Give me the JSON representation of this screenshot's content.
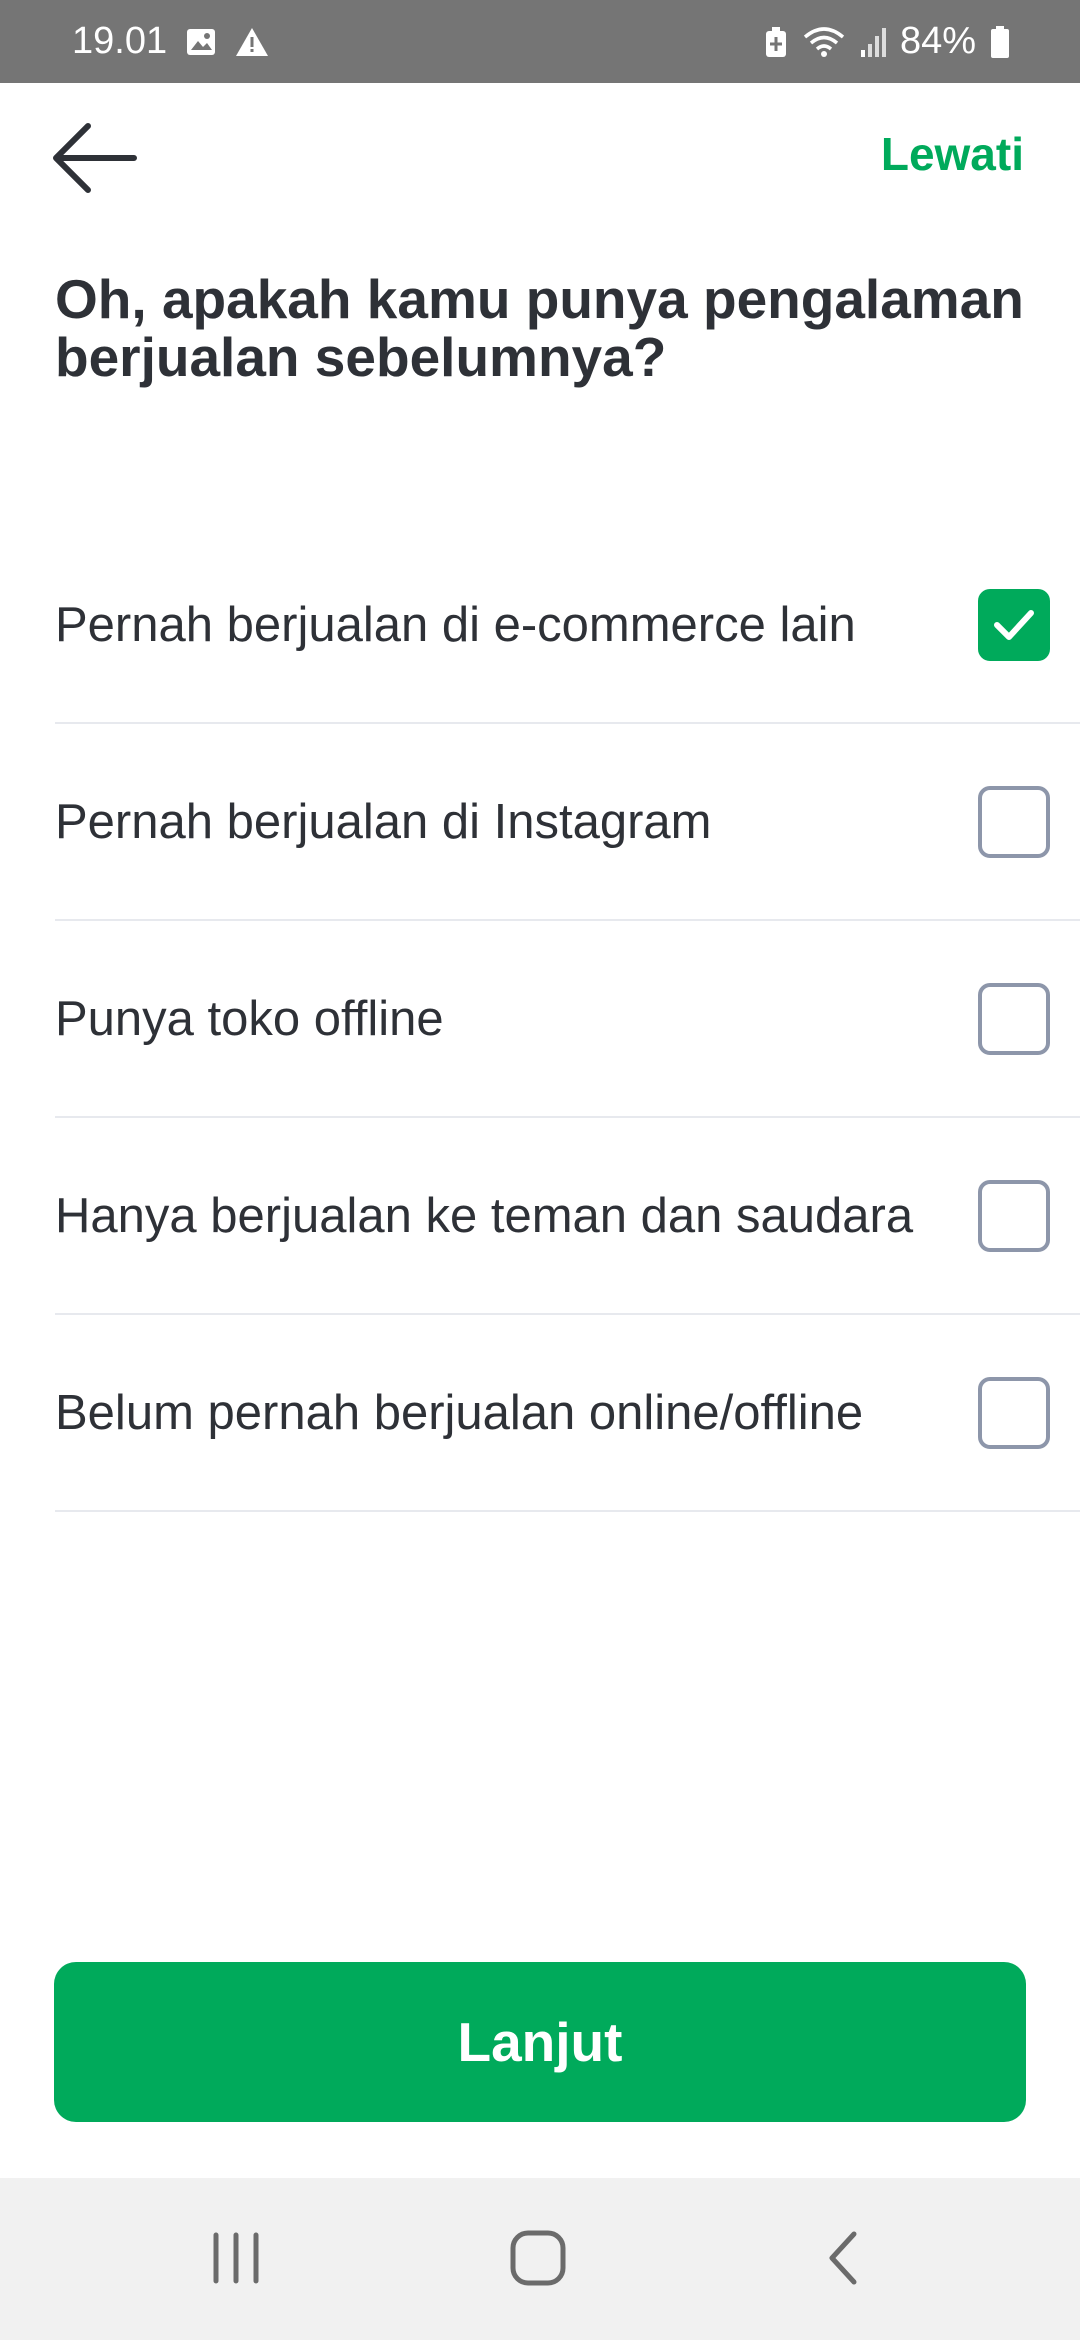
{
  "status_bar": {
    "time": "19.01",
    "battery": "84%",
    "icons": [
      "gallery-icon",
      "warning-icon",
      "battery-saver-icon",
      "wifi-icon",
      "signal-icon",
      "battery-icon"
    ]
  },
  "app_bar": {
    "back_icon": "arrow-left-icon",
    "skip_label": "Lewati"
  },
  "question": {
    "line1": "Oh, apakah kamu punya pengalaman",
    "line2": "berjualan sebelumnya?"
  },
  "options": [
    {
      "label": "Pernah berjualan di e-commerce lain",
      "checked": true
    },
    {
      "label": "Pernah berjualan di Instagram",
      "checked": false
    },
    {
      "label": "Punya toko offline",
      "checked": false
    },
    {
      "label": "Hanya berjualan ke teman dan saudara",
      "checked": false
    },
    {
      "label": "Belum pernah berjualan online/offline",
      "checked": false
    }
  ],
  "continue_label": "Lanjut",
  "colors": {
    "accent": "#00aa5b",
    "text": "#2e3137",
    "checkbox_border": "#8d96aa",
    "status_bar": "#757575",
    "nav_bar": "#f1f1f1"
  },
  "nav_bar": {
    "icons": [
      "recent-apps-icon",
      "home-icon",
      "back-nav-icon"
    ]
  }
}
